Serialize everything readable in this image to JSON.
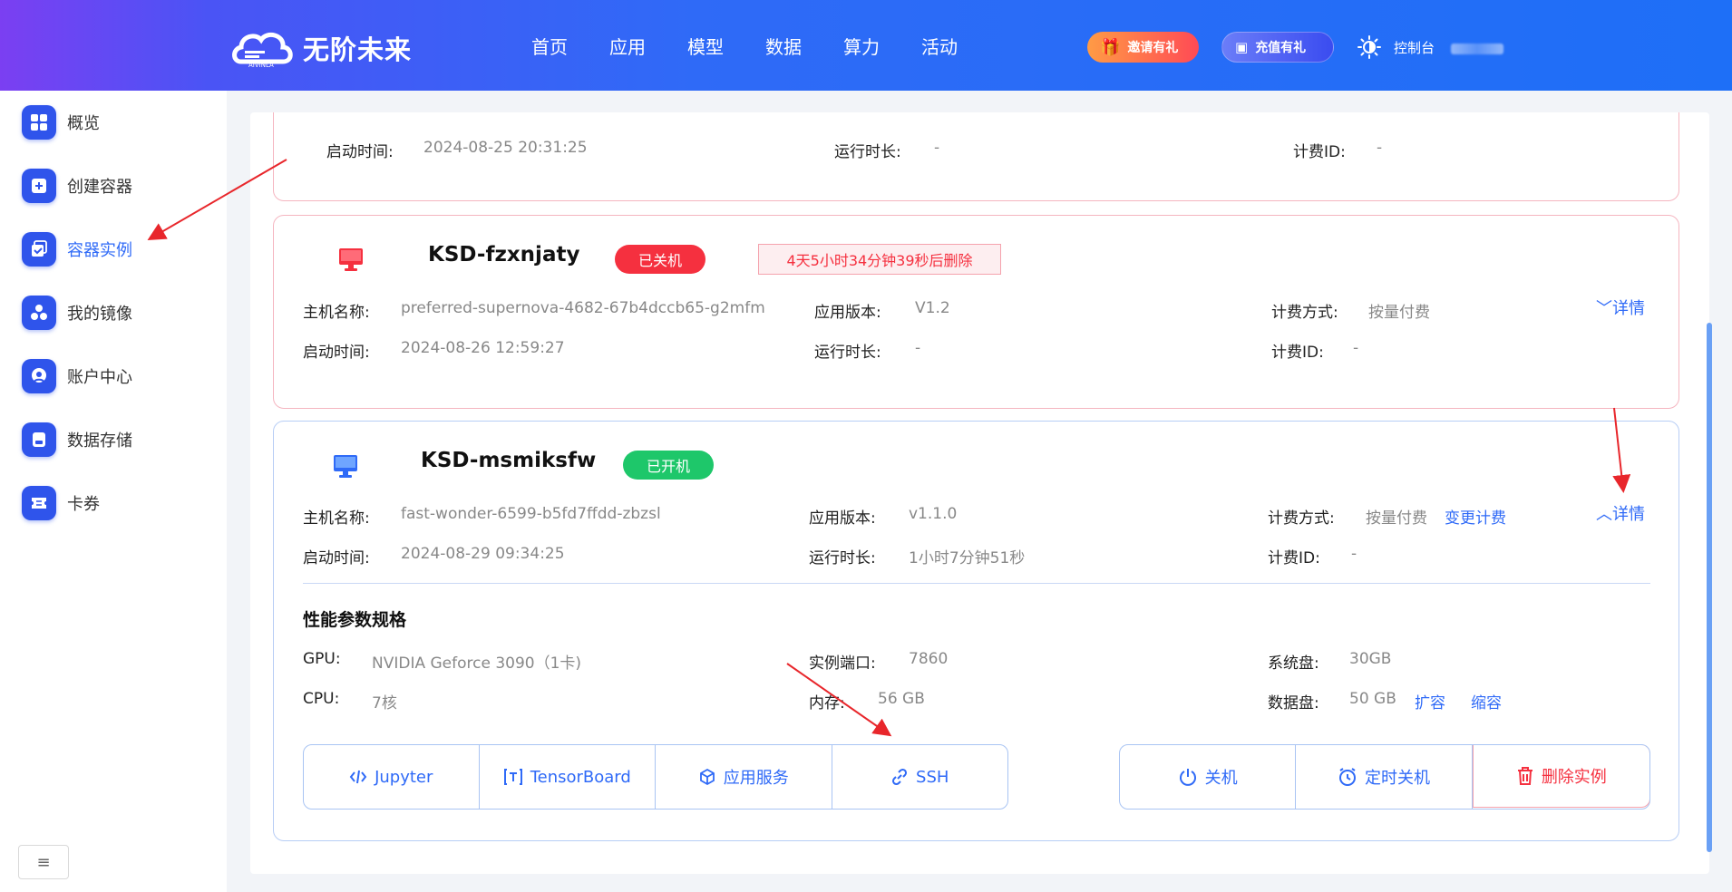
{
  "header": {
    "logo_text": "无阶未来",
    "logo_sub": "AIVINLA",
    "nav": [
      "首页",
      "应用",
      "模型",
      "数据",
      "算力",
      "活动"
    ],
    "invite_label": "邀请有礼",
    "recharge_label": "充值有礼",
    "console_label": "控制台"
  },
  "sidebar": {
    "items": [
      {
        "label": "概览",
        "icon": "grid-icon"
      },
      {
        "label": "创建容器",
        "icon": "plus-icon"
      },
      {
        "label": "容器实例",
        "icon": "container-icon"
      },
      {
        "label": "我的镜像",
        "icon": "cubes-icon"
      },
      {
        "label": "账户中心",
        "icon": "user-icon"
      },
      {
        "label": "数据存储",
        "icon": "storage-icon"
      },
      {
        "label": "卡券",
        "icon": "coupon-icon"
      }
    ],
    "active_index": 2,
    "collapse_label": "≡"
  },
  "labels": {
    "hostname": "主机名称:",
    "start_time": "启动时间:",
    "app_version": "应用版本:",
    "runtime": "运行时长:",
    "billing_method": "计费方式:",
    "billing_id": "计费ID:",
    "detail": "详情"
  },
  "cards": [
    {
      "start_time": "2024-08-25 20:31:25",
      "runtime": "-",
      "billing_id": "-"
    },
    {
      "name": "KSD-fzxnjaty",
      "status": "已关机",
      "delete_notice": "4天5小时34分钟39秒后删除",
      "hostname": "preferred-supernova-4682-67b4dccb65-g2mfm",
      "app_version": "V1.2",
      "billing_method": "按量付费",
      "start_time": "2024-08-26 12:59:27",
      "runtime": "-",
      "billing_id": "-"
    },
    {
      "name": "KSD-msmiksfw",
      "status": "已开机",
      "hostname": "fast-wonder-6599-b5fd7ffdd-zbzsl",
      "app_version": "v1.1.0",
      "billing_method": "按量付费",
      "change_billing": "变更计费",
      "start_time": "2024-08-29 09:34:25",
      "runtime": "1小时7分钟51秒",
      "billing_id": "-",
      "spec_title": "性能参数规格",
      "specs": {
        "gpu_label": "GPU:",
        "gpu": "NVIDIA Geforce 3090（1卡)",
        "port_label": "实例端口:",
        "port": "7860",
        "sysdisk_label": "系统盘:",
        "sysdisk": "30GB",
        "cpu_label": "CPU:",
        "cpu": "7核",
        "mem_label": "内存:",
        "mem": "56 GB",
        "datadisk_label": "数据盘:",
        "datadisk": "50 GB",
        "expand": "扩容",
        "shrink": "缩容"
      },
      "tools": [
        "Jupyter",
        "TensorBoard",
        "应用服务",
        "SSH"
      ],
      "actions": [
        "关机",
        "定时关机",
        "删除实例"
      ]
    }
  ],
  "colors": {
    "primary": "#2f6af7",
    "danger": "#f5303f",
    "success": "#1ec76a"
  }
}
